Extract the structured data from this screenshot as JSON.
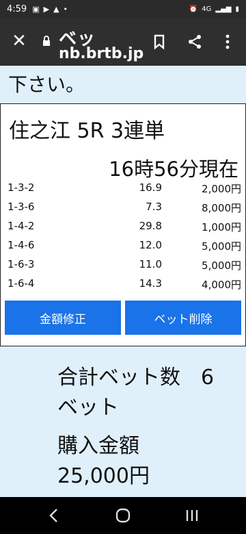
{
  "status_bar": {
    "time": "4:59",
    "icons": [
      "image-icon",
      "play-icon",
      "warning-icon",
      "dot-icon"
    ],
    "right_text": "4G"
  },
  "browser": {
    "page_title": "ベッ",
    "url": "nb.brtb.jp",
    "close_icon": "close-icon",
    "bookmark_icon": "bookmark-icon",
    "share_icon": "share-icon",
    "menu_icon": "more-vert-icon"
  },
  "page": {
    "top_text": "下さい。",
    "race_title": "住之江 5R 3連単",
    "now_time": "16時56分現在",
    "bets": [
      {
        "combo": "1-3-2",
        "odds": "16.9",
        "amount": "2,000円"
      },
      {
        "combo": "1-3-6",
        "odds": "7.3",
        "amount": "8,000円"
      },
      {
        "combo": "1-4-2",
        "odds": "29.8",
        "amount": "1,000円"
      },
      {
        "combo": "1-4-6",
        "odds": "12.0",
        "amount": "5,000円"
      },
      {
        "combo": "1-6-3",
        "odds": "11.0",
        "amount": "5,000円"
      },
      {
        "combo": "1-6-4",
        "odds": "14.3",
        "amount": "4,000円"
      }
    ],
    "edit_button": "金額修正",
    "delete_button": "ベット削除",
    "summary_line1": "合計ベット数　6",
    "summary_line2": "ベット",
    "summary_line3": "購入金額",
    "summary_line4": "25,000円"
  },
  "nav": {
    "back": "back-icon",
    "home": "home-icon",
    "recents": "recents-icon"
  }
}
